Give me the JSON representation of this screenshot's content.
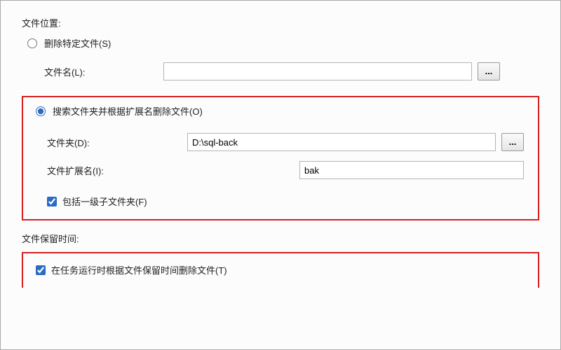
{
  "sections": {
    "file_location_label": "文件位置:",
    "retention_label": "文件保留时间:"
  },
  "radios": {
    "delete_specific_label": "删除特定文件(S)",
    "delete_specific_checked": false,
    "search_folder_label": "搜索文件夹并根据扩展名删除文件(O)",
    "search_folder_checked": true
  },
  "fields": {
    "filename_label": "文件名(L):",
    "filename_value": "",
    "folder_label": "文件夹(D):",
    "folder_value": "D:\\sql-back",
    "extension_label": "文件扩展名(I):",
    "extension_value": "bak"
  },
  "checkboxes": {
    "include_subfolders_label": "包括一级子文件夹(F)",
    "include_subfolders_checked": true,
    "delete_by_retention_label": "在任务运行时根据文件保留时间删除文件(T)",
    "delete_by_retention_checked": true
  },
  "browse_button_label": "..."
}
